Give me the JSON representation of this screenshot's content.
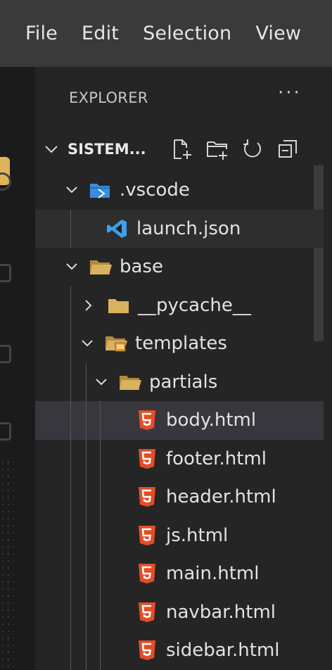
{
  "menubar": {
    "items": [
      "File",
      "Edit",
      "Selection",
      "View"
    ]
  },
  "explorer": {
    "title": "EXPLORER",
    "more_actions": "···",
    "section_title": "SISTEM...",
    "section_actions": [
      "new-file-icon",
      "new-folder-icon",
      "refresh-icon",
      "collapse-all-icon"
    ],
    "tree": [
      {
        "label": ".vscode",
        "depth": 0,
        "type": "folder",
        "expanded": true,
        "icon": "vscode-folder-icon",
        "state": "normal"
      },
      {
        "label": "launch.json",
        "depth": 1,
        "type": "file",
        "icon": "vscode-logo-icon",
        "state": "hover"
      },
      {
        "label": "base",
        "depth": 0,
        "type": "folder",
        "expanded": true,
        "icon": "folder-icon",
        "state": "normal"
      },
      {
        "label": "__pycache__",
        "depth": 1,
        "type": "folder",
        "expanded": false,
        "icon": "folder-icon",
        "state": "normal"
      },
      {
        "label": "templates",
        "depth": 1,
        "type": "folder",
        "expanded": true,
        "icon": "templates-folder-icon",
        "state": "normal"
      },
      {
        "label": "partials",
        "depth": 2,
        "type": "folder",
        "expanded": true,
        "icon": "folder-icon",
        "state": "normal"
      },
      {
        "label": "body.html",
        "depth": 3,
        "type": "file",
        "icon": "html5-icon",
        "state": "selected"
      },
      {
        "label": "footer.html",
        "depth": 3,
        "type": "file",
        "icon": "html5-icon",
        "state": "normal"
      },
      {
        "label": "header.html",
        "depth": 3,
        "type": "file",
        "icon": "html5-icon",
        "state": "normal"
      },
      {
        "label": "js.html",
        "depth": 3,
        "type": "file",
        "icon": "html5-icon",
        "state": "normal"
      },
      {
        "label": "main.html",
        "depth": 3,
        "type": "file",
        "icon": "html5-icon",
        "state": "normal"
      },
      {
        "label": "navbar.html",
        "depth": 3,
        "type": "file",
        "icon": "html5-icon",
        "state": "normal"
      },
      {
        "label": "sidebar.html",
        "depth": 3,
        "type": "file",
        "icon": "html5-icon",
        "state": "normal"
      }
    ]
  },
  "colors": {
    "menubar_bg": "#3a3a3a",
    "sidebar_bg": "#252526",
    "html_orange": "#e44d26",
    "folder_tan": "#d9b25f",
    "vscode_blue": "#3ea0e8"
  }
}
